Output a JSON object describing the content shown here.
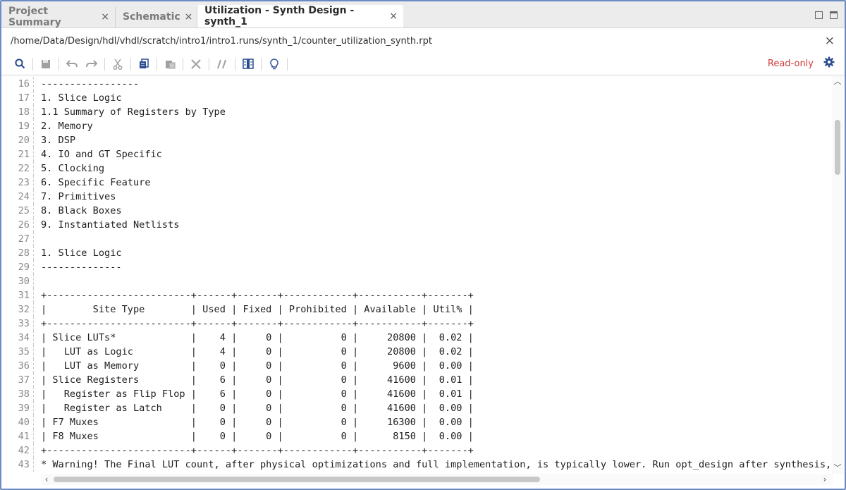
{
  "tabs": [
    {
      "label": "Project Summary",
      "close": "×",
      "active": false
    },
    {
      "label": "Schematic",
      "close": "×",
      "active": false
    },
    {
      "label": "Utilization - Synth Design - synth_1",
      "close": "×",
      "active": true
    }
  ],
  "path": {
    "text": "/home/Data/Design/hdl/vhdl/scratch/intro1/intro1.runs/synth_1/counter_utilization_synth.rpt",
    "close": "×"
  },
  "toolbar": {
    "icons": [
      "search-icon",
      "save-icon",
      "undo-icon",
      "redo-icon",
      "cut-icon",
      "copy-icon",
      "paste-icon",
      "delete-icon",
      "comment-icon",
      "columns-icon",
      "lightbulb-icon"
    ],
    "readonly_label": "Read-only",
    "settings_icon": "gear-icon"
  },
  "colors": {
    "accent": "#2a4d8f",
    "readonly": "#d03a3a",
    "frame_border": "#6a8cc4"
  },
  "editor": {
    "lines": [
      {
        "num": "16",
        "text": "-----------------"
      },
      {
        "num": "17",
        "text": "1. Slice Logic"
      },
      {
        "num": "18",
        "text": "1.1 Summary of Registers by Type"
      },
      {
        "num": "19",
        "text": "2. Memory"
      },
      {
        "num": "20",
        "text": "3. DSP"
      },
      {
        "num": "21",
        "text": "4. IO and GT Specific"
      },
      {
        "num": "22",
        "text": "5. Clocking"
      },
      {
        "num": "23",
        "text": "6. Specific Feature"
      },
      {
        "num": "24",
        "text": "7. Primitives"
      },
      {
        "num": "25",
        "text": "8. Black Boxes"
      },
      {
        "num": "26",
        "text": "9. Instantiated Netlists"
      },
      {
        "num": "27",
        "text": ""
      },
      {
        "num": "28",
        "text": "1. Slice Logic"
      },
      {
        "num": "29",
        "text": "--------------"
      },
      {
        "num": "30",
        "text": ""
      },
      {
        "num": "31",
        "text": "+-------------------------+------+-------+------------+-----------+-------+"
      },
      {
        "num": "32",
        "text": "|        Site Type        | Used | Fixed | Prohibited | Available | Util% |"
      },
      {
        "num": "33",
        "text": "+-------------------------+------+-------+------------+-----------+-------+"
      },
      {
        "num": "34",
        "text": "| Slice LUTs*             |    4 |     0 |          0 |     20800 |  0.02 |"
      },
      {
        "num": "35",
        "text": "|   LUT as Logic          |    4 |     0 |          0 |     20800 |  0.02 |"
      },
      {
        "num": "36",
        "text": "|   LUT as Memory         |    0 |     0 |          0 |      9600 |  0.00 |"
      },
      {
        "num": "37",
        "text": "| Slice Registers         |    6 |     0 |          0 |     41600 |  0.01 |"
      },
      {
        "num": "38",
        "text": "|   Register as Flip Flop |    6 |     0 |          0 |     41600 |  0.01 |"
      },
      {
        "num": "39",
        "text": "|   Register as Latch     |    0 |     0 |          0 |     41600 |  0.00 |"
      },
      {
        "num": "40",
        "text": "| F7 Muxes                |    0 |     0 |          0 |     16300 |  0.00 |"
      },
      {
        "num": "41",
        "text": "| F8 Muxes                |    0 |     0 |          0 |      8150 |  0.00 |"
      },
      {
        "num": "42",
        "text": "+-------------------------+------+-------+------------+-----------+-------+"
      },
      {
        "num": "43",
        "text": "* Warning! The Final LUT count, after physical optimizations and full implementation, is typically lower. Run opt_design after synthesis, if"
      }
    ]
  }
}
